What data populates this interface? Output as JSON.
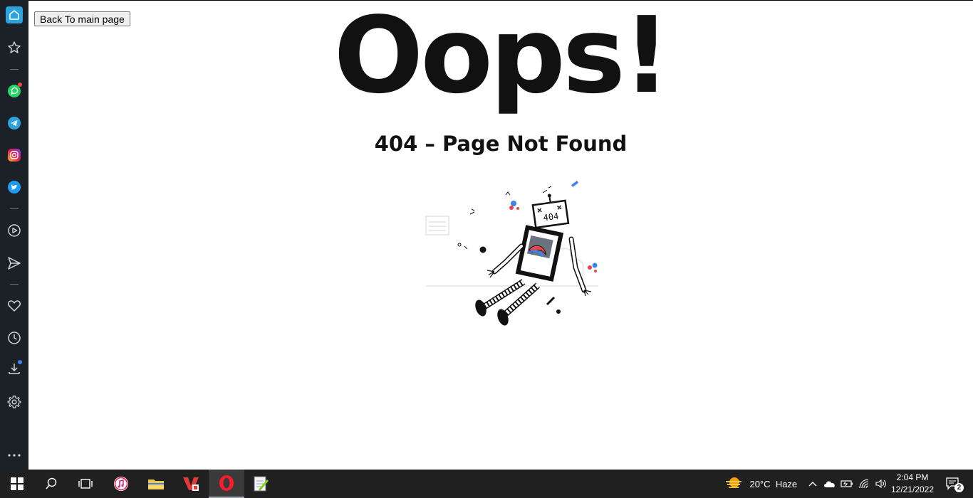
{
  "sidebar": {
    "items": [
      {
        "name": "home-icon"
      },
      {
        "name": "star-icon"
      },
      {
        "name": "whatsapp-icon",
        "badge_color": "#ef4444"
      },
      {
        "name": "telegram-icon"
      },
      {
        "name": "instagram-icon"
      },
      {
        "name": "twitter-icon"
      },
      {
        "name": "player-icon"
      },
      {
        "name": "send-icon"
      },
      {
        "name": "heart-icon"
      },
      {
        "name": "history-icon"
      },
      {
        "name": "download-icon",
        "badge_color": "#3b82f6"
      },
      {
        "name": "settings-icon"
      },
      {
        "name": "more-icon"
      }
    ]
  },
  "page": {
    "back_button_label": "Back To main page",
    "heading": "Oops!",
    "subtitle": "404 – Page Not Found",
    "illustration": "broken-robot-404",
    "robot_face_text": "404"
  },
  "taskbar": {
    "apps": [
      {
        "name": "start-icon"
      },
      {
        "name": "search-icon"
      },
      {
        "name": "task-view-icon"
      },
      {
        "name": "itunes-icon"
      },
      {
        "name": "file-explorer-icon"
      },
      {
        "name": "wps-office-icon"
      },
      {
        "name": "opera-icon",
        "active": true
      },
      {
        "name": "notepad-plus-icon"
      }
    ],
    "weather": {
      "temperature": "20°C",
      "condition": "Haze"
    },
    "clock": {
      "time": "2:04 PM",
      "date": "12/21/2022"
    },
    "notifications_count": "2"
  },
  "colors": {
    "sidebar_bg": "#1c2128",
    "taskbar_bg": "#202020",
    "whatsapp": "#25d366",
    "telegram": "#2aa3df",
    "twitter": "#1d9bf0",
    "opera": "#ff1b2d",
    "home_accent": "#2aa3df"
  }
}
